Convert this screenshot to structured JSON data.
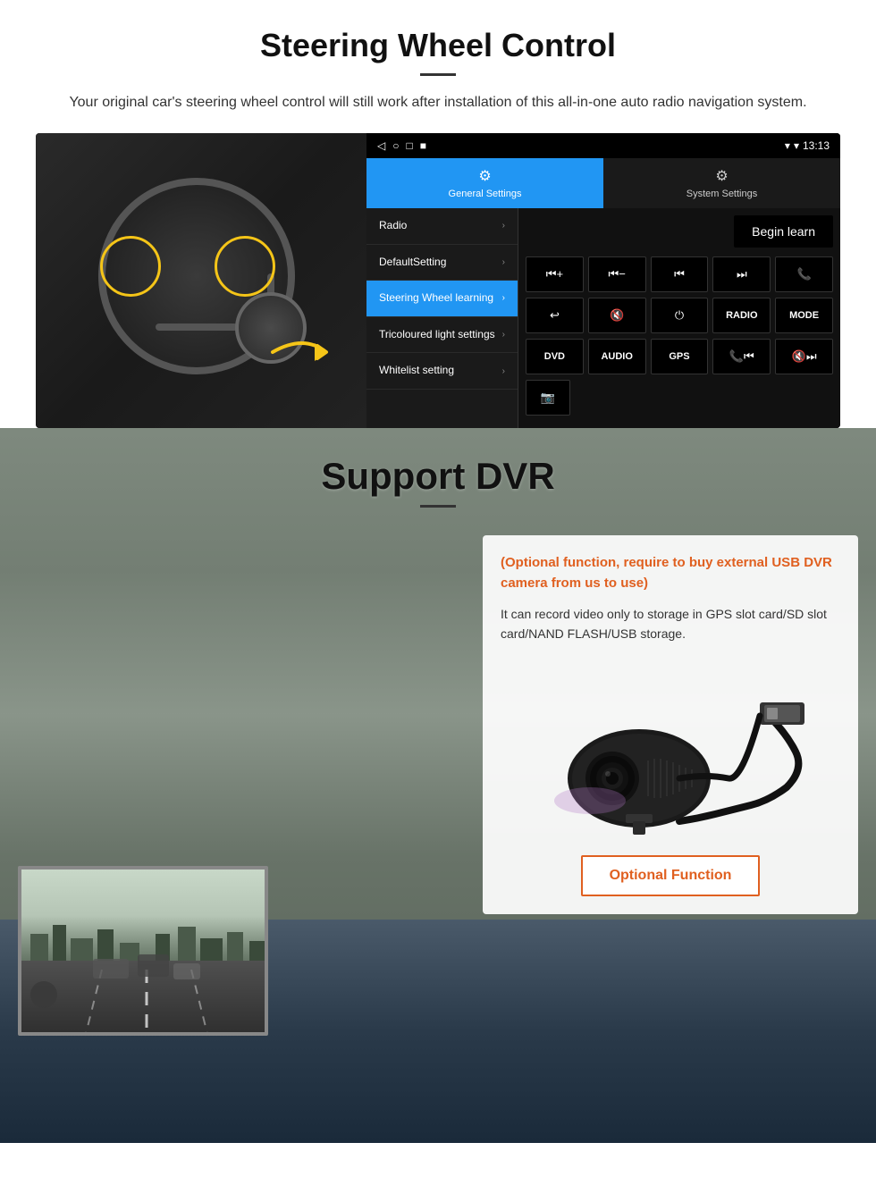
{
  "steering_section": {
    "title": "Steering Wheel Control",
    "subtitle": "Your original car's steering wheel control will still work after installation of this all-in-one auto radio navigation system.",
    "statusbar": {
      "time": "13:13",
      "icons": [
        "◁",
        "○",
        "□",
        "■"
      ]
    },
    "tabs": [
      {
        "label": "General Settings",
        "icon": "⚙",
        "active": true
      },
      {
        "label": "System Settings",
        "icon": "🔧",
        "active": false
      }
    ],
    "menu_items": [
      {
        "label": "Radio",
        "active": false
      },
      {
        "label": "DefaultSetting",
        "active": false
      },
      {
        "label": "Steering Wheel learning",
        "active": true
      },
      {
        "label": "Tricoloured light settings",
        "active": false
      },
      {
        "label": "Whitelist setting",
        "active": false
      }
    ],
    "begin_learn_label": "Begin learn",
    "control_buttons_row1": [
      "⏮+",
      "⏮-",
      "⏮",
      "⏭",
      "📞"
    ],
    "control_buttons_row2": [
      "↩",
      "🔇",
      "⏻",
      "RADIO",
      "MODE"
    ],
    "control_buttons_row3": [
      "DVD",
      "AUDIO",
      "GPS",
      "📞⏮",
      "🔇⏭"
    ],
    "control_buttons_row4": [
      "📷"
    ]
  },
  "dvr_section": {
    "title": "Support DVR",
    "optional_text": "(Optional function, require to buy external USB DVR camera from us to use)",
    "description": "It can record video only to storage in GPS slot card/SD slot card/NAND FLASH/USB storage.",
    "optional_function_label": "Optional Function"
  }
}
